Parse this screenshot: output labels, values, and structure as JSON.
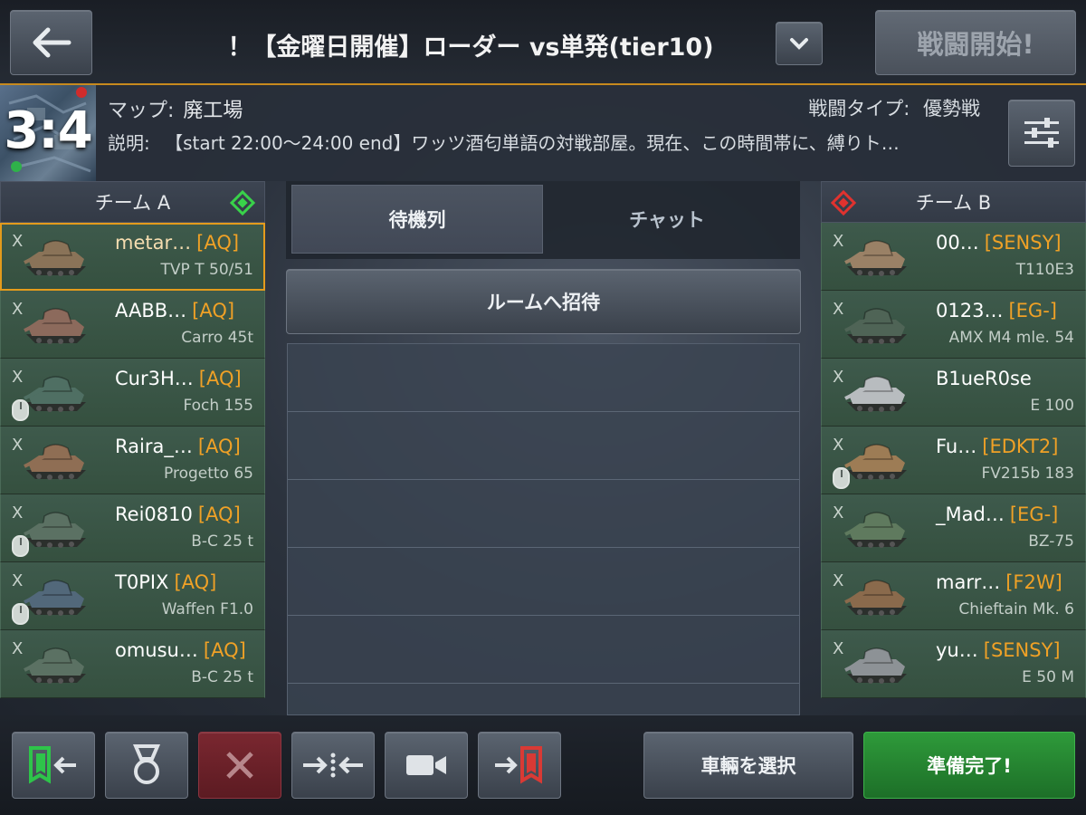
{
  "header": {
    "title": "！【金曜日開催】ローダー vs単発(tier10)",
    "start_label": "戦闘開始!"
  },
  "info": {
    "score": "3:4",
    "map_label": "マップ:",
    "map_value": "廃工場",
    "battle_type_label": "戦闘タイプ:",
    "battle_type_value": "優勢戦",
    "description_label": "説明:",
    "description": "【start 22:00〜24:00 end】ワッツ酒匂単語の対戦部屋。現在、この時間帯に、縛りト…"
  },
  "team_a": {
    "name": "チーム A",
    "players": [
      {
        "x": "X",
        "name": "metar…",
        "clan": "[AQ]",
        "tank": "TVP T 50/51",
        "mouse": false,
        "selected": true,
        "tank_color": "#8a7358"
      },
      {
        "x": "X",
        "name": "AABB…",
        "clan": "[AQ]",
        "tank": "Carro 45t",
        "mouse": false,
        "selected": false,
        "tank_color": "#8c6a5c"
      },
      {
        "x": "X",
        "name": "Cur3H…",
        "clan": "[AQ]",
        "tank": "Foch 155",
        "mouse": true,
        "selected": false,
        "tank_color": "#4f6f63"
      },
      {
        "x": "X",
        "name": "Raira_…",
        "clan": "[AQ]",
        "tank": "Progetto 65",
        "mouse": false,
        "selected": false,
        "tank_color": "#8f6e54"
      },
      {
        "x": "X",
        "name": "Rei0810",
        "clan": "[AQ]",
        "tank": "B-C 25 t",
        "mouse": true,
        "selected": false,
        "tank_color": "#5b7163"
      },
      {
        "x": "X",
        "name": "T0PIX",
        "clan": "[AQ]",
        "tank": "Waffen F1.0",
        "mouse": true,
        "selected": false,
        "tank_color": "#52687a"
      },
      {
        "x": "X",
        "name": "omusu…",
        "clan": "[AQ]",
        "tank": "B-C 25 t",
        "mouse": false,
        "selected": false,
        "tank_color": "#5b7163"
      }
    ]
  },
  "team_b": {
    "name": "チーム B",
    "players": [
      {
        "x": "X",
        "name": "00…",
        "clan": "[SENSY]",
        "tank": "T110E3",
        "mouse": false,
        "tank_color": "#9a8166"
      },
      {
        "x": "X",
        "name": "0123…",
        "clan": "[EG-]",
        "tank": "AMX M4 mle. 54",
        "mouse": false,
        "tank_color": "#4f6456"
      },
      {
        "x": "X",
        "name": "B1ueR0se",
        "clan": "",
        "tank": "E 100",
        "mouse": false,
        "tank_color": "#b8bcbf"
      },
      {
        "x": "X",
        "name": "Fu…",
        "clan": "[EDKT2]",
        "tank": "FV215b 183",
        "mouse": true,
        "tank_color": "#9d7c55"
      },
      {
        "x": "X",
        "name": "_Mad…",
        "clan": "[EG-]",
        "tank": "BZ-75",
        "mouse": false,
        "tank_color": "#5f7a5e"
      },
      {
        "x": "X",
        "name": "marr…",
        "clan": "[F2W]",
        "tank": "Chieftain Mk. 6",
        "mouse": false,
        "tank_color": "#8a6a4c"
      },
      {
        "x": "X",
        "name": "yu…",
        "clan": "[SENSY]",
        "tank": "E 50 M",
        "mouse": false,
        "tank_color": "#8d9296"
      }
    ]
  },
  "middle": {
    "tab_queue": "待機列",
    "tab_chat": "チャット",
    "invite_label": "ルームへ招待"
  },
  "bottom": {
    "select_vehicle": "車輛を選択",
    "ready": "準備完了!"
  },
  "colors": {
    "accent_orange": "#e49b1c",
    "clan_orange": "#f0a126",
    "team_a_green": "#39d24a",
    "team_b_red": "#e0322f",
    "ready_green": "#2e9a3a"
  }
}
